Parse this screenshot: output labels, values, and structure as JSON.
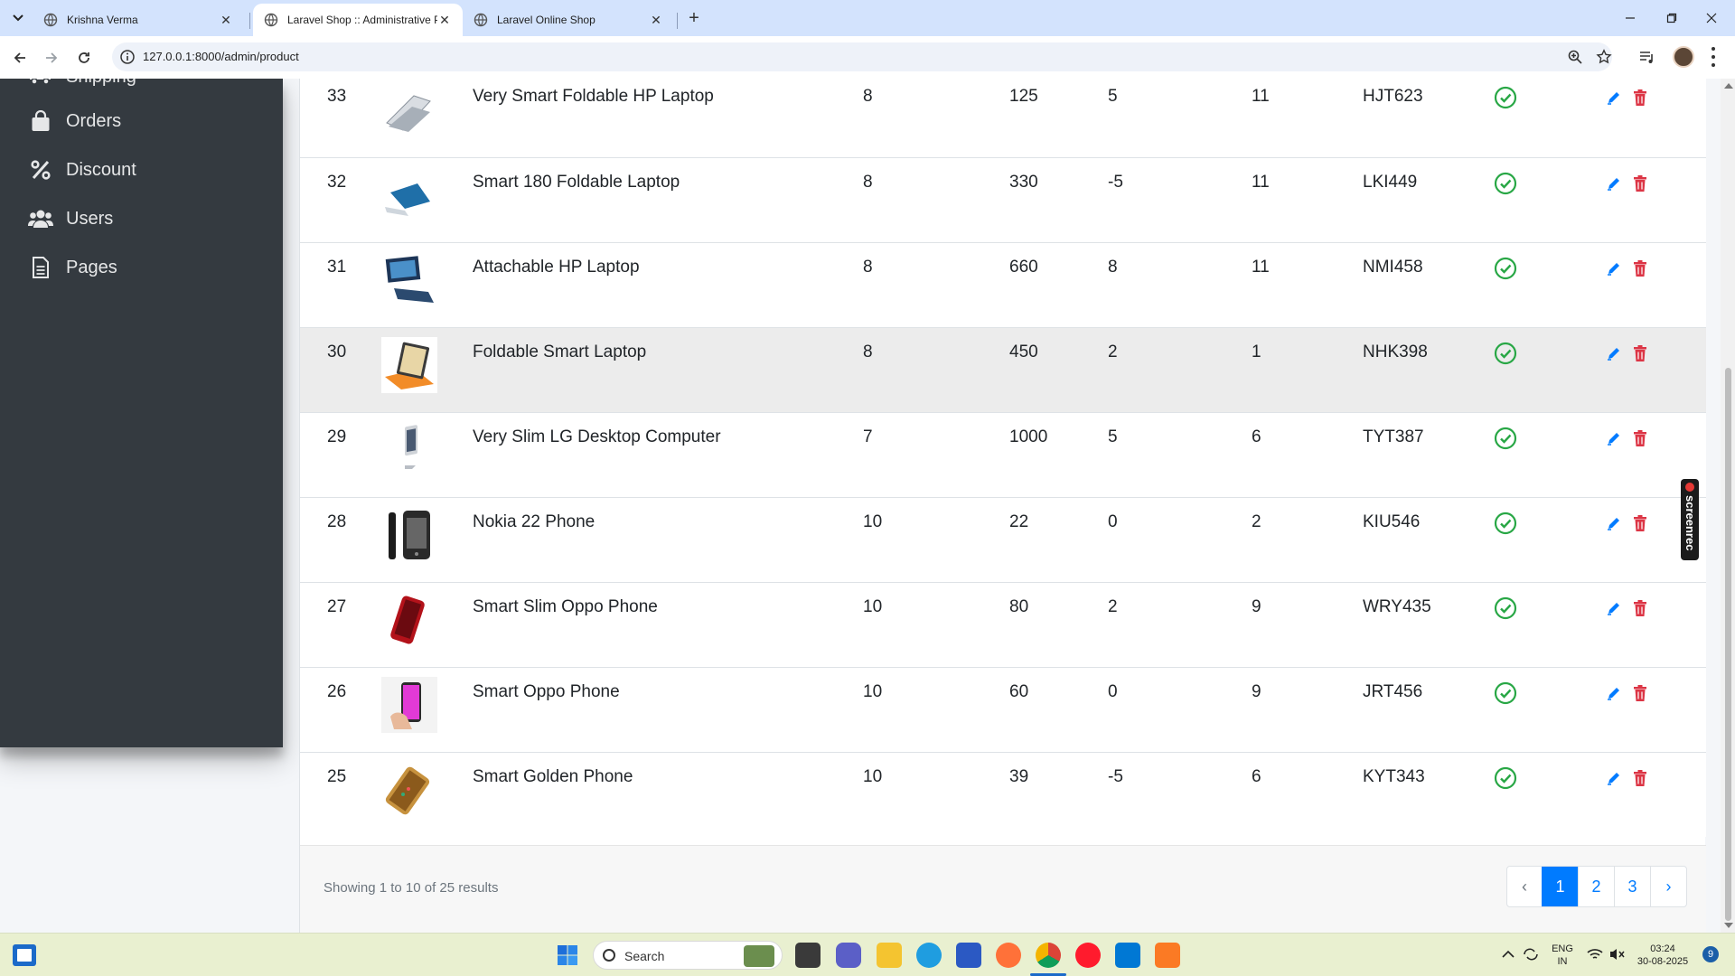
{
  "browser": {
    "tabs": [
      {
        "title": "Krishna Verma",
        "active": false
      },
      {
        "title": "Laravel Shop :: Administrative P",
        "active": true
      },
      {
        "title": "Laravel Online Shop",
        "active": false
      }
    ],
    "url": "127.0.0.1:8000/admin/product"
  },
  "sidebar": {
    "items": [
      {
        "label": "Shipping",
        "icon": "truck-icon"
      },
      {
        "label": "Orders",
        "icon": "shopping-bag-icon"
      },
      {
        "label": "Discount",
        "icon": "percent-icon"
      },
      {
        "label": "Users",
        "icon": "users-icon"
      },
      {
        "label": "Pages",
        "icon": "file-icon"
      }
    ]
  },
  "products": [
    {
      "id": "33",
      "image": "laptop-silver",
      "name": "Very Smart Foldable HP Laptop",
      "category": "8",
      "price": "125",
      "discount": "5",
      "qty": "11",
      "sku": "HJT623",
      "status": "active"
    },
    {
      "id": "32",
      "image": "laptop-blue",
      "name": "Smart 180 Foldable Laptop",
      "category": "8",
      "price": "330",
      "discount": "-5",
      "qty": "11",
      "sku": "LKI449",
      "status": "active"
    },
    {
      "id": "31",
      "image": "laptop-navy",
      "name": "Attachable HP Laptop",
      "category": "8",
      "price": "660",
      "discount": "8",
      "qty": "11",
      "sku": "NMI458",
      "status": "active"
    },
    {
      "id": "30",
      "image": "tablet-orange",
      "name": "Foldable Smart Laptop",
      "category": "8",
      "price": "450",
      "discount": "2",
      "qty": "1",
      "sku": "NHK398",
      "status": "active"
    },
    {
      "id": "29",
      "image": "desktop-imac",
      "name": "Very Slim LG Desktop Computer",
      "category": "7",
      "price": "1000",
      "discount": "5",
      "qty": "6",
      "sku": "TYT387",
      "status": "active"
    },
    {
      "id": "28",
      "image": "phone-black",
      "name": "Nokia 22 Phone",
      "category": "10",
      "price": "22",
      "discount": "0",
      "qty": "2",
      "sku": "KIU546",
      "status": "active"
    },
    {
      "id": "27",
      "image": "phone-red",
      "name": "Smart Slim Oppo Phone",
      "category": "10",
      "price": "80",
      "discount": "2",
      "qty": "9",
      "sku": "WRY435",
      "status": "active"
    },
    {
      "id": "26",
      "image": "phone-pink",
      "name": "Smart Oppo Phone",
      "category": "10",
      "price": "60",
      "discount": "0",
      "qty": "9",
      "sku": "JRT456",
      "status": "active"
    },
    {
      "id": "25",
      "image": "phone-gold",
      "name": "Smart Golden Phone",
      "category": "10",
      "price": "39",
      "discount": "-5",
      "qty": "6",
      "sku": "KYT343",
      "status": "active"
    }
  ],
  "pagination": {
    "summary": "Showing 1 to 10 of 25 results",
    "prev": "‹",
    "pages": [
      "1",
      "2",
      "3"
    ],
    "current": "1",
    "next": "›"
  },
  "overlay": {
    "screenrec": "screenrec"
  },
  "taskbar": {
    "search_label": "Search",
    "lang_top": "ENG",
    "lang_bottom": "IN",
    "time": "03:24",
    "date": "30-08-2025",
    "notifications": "9"
  },
  "colors": {
    "sidebar_bg": "#343a40",
    "primary": "#007bff",
    "success": "#28a745",
    "danger": "#dc3545",
    "tabbar_bg": "#d3e3fd",
    "taskbar_bg": "#e9f0d0"
  }
}
